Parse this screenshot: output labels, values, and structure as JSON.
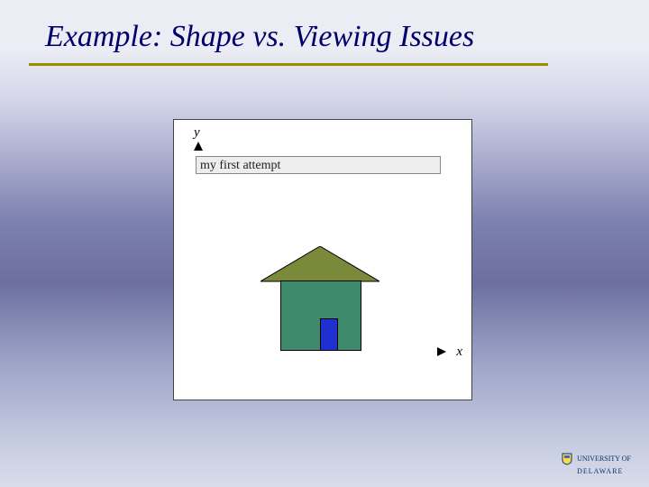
{
  "title": "Example: Shape vs. Viewing Issues",
  "figure": {
    "y_axis_label": "y",
    "x_axis_label": "x",
    "caption": "my first attempt"
  },
  "house": {
    "wall_color": "#3f8a6d",
    "roof_color": "#7a8a3a",
    "door_color": "#2030d0"
  },
  "branding": {
    "line1": "UNIVERSITY OF",
    "line2": "DELAWARE"
  }
}
